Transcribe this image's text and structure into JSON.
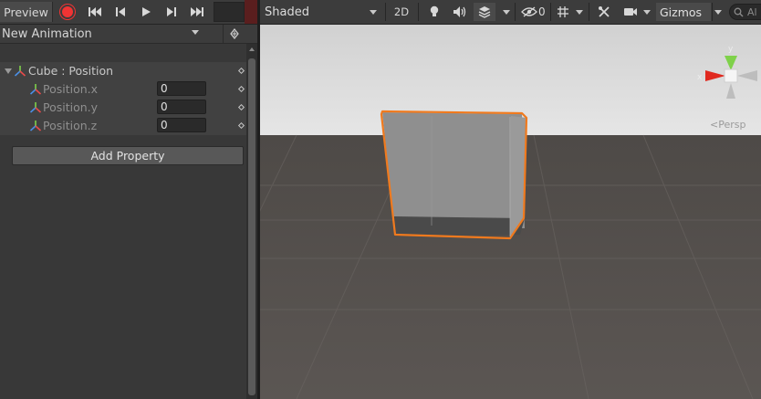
{
  "animation": {
    "toolbar": {
      "preview_label": "Preview",
      "icons": [
        "record-icon",
        "first-keyframe-icon",
        "previous-keyframe-icon",
        "play-icon",
        "next-keyframe-icon",
        "last-keyframe-icon"
      ],
      "record_color": "#f03434"
    },
    "clip": {
      "selected": "New Animation"
    },
    "properties": {
      "group_label": "Cube : Position",
      "items": [
        {
          "label": "Position.x",
          "value": "0"
        },
        {
          "label": "Position.y",
          "value": "0"
        },
        {
          "label": "Position.z",
          "value": "0"
        }
      ]
    },
    "add_property_label": "Add Property"
  },
  "scene": {
    "toolbar": {
      "shading_mode": "Shaded",
      "mode_2d": "2D",
      "hidden_count": "0",
      "gizmos_label": "Gizmos",
      "search_placeholder": "Al",
      "icons": [
        "lighting-icon",
        "audio-icon",
        "effects-icon",
        "visibility-icon",
        "grid-icon",
        "tools-icon",
        "camera-icon",
        "search-icon"
      ]
    },
    "orientation_gizmo": {
      "x_label": "x",
      "y_label": "y"
    },
    "projection_label": "Persp",
    "selection_outline_color": "#f07a1e"
  }
}
